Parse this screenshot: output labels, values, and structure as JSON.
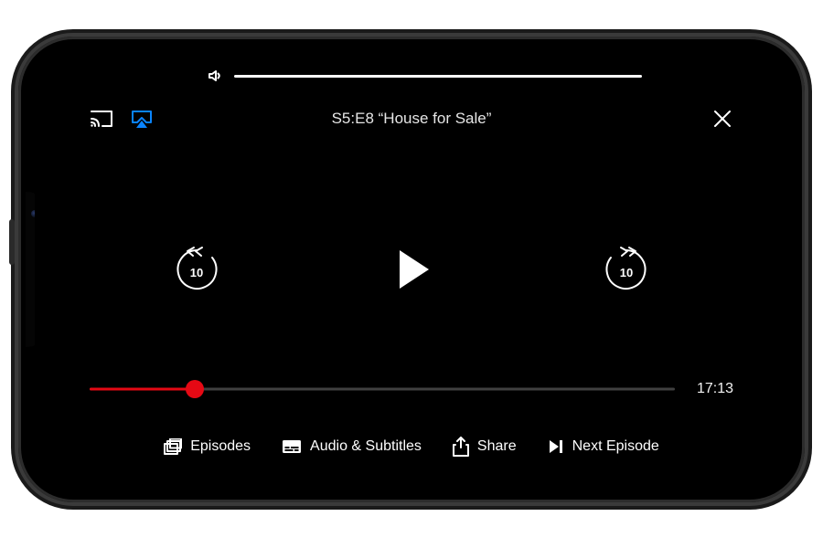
{
  "header": {
    "title": "S5:E8 “House for Sale”"
  },
  "volume": {
    "level_percent": 100
  },
  "playback": {
    "rewind_seconds": "10",
    "forward_seconds": "10",
    "progress_percent": 18,
    "time_remaining": "17:13"
  },
  "actions": {
    "episodes": "Episodes",
    "audio_subtitles": "Audio & Subtitles",
    "share": "Share",
    "next_episode": "Next Episode"
  },
  "colors": {
    "accent": "#e50914",
    "airplay_active": "#0a84ff"
  }
}
